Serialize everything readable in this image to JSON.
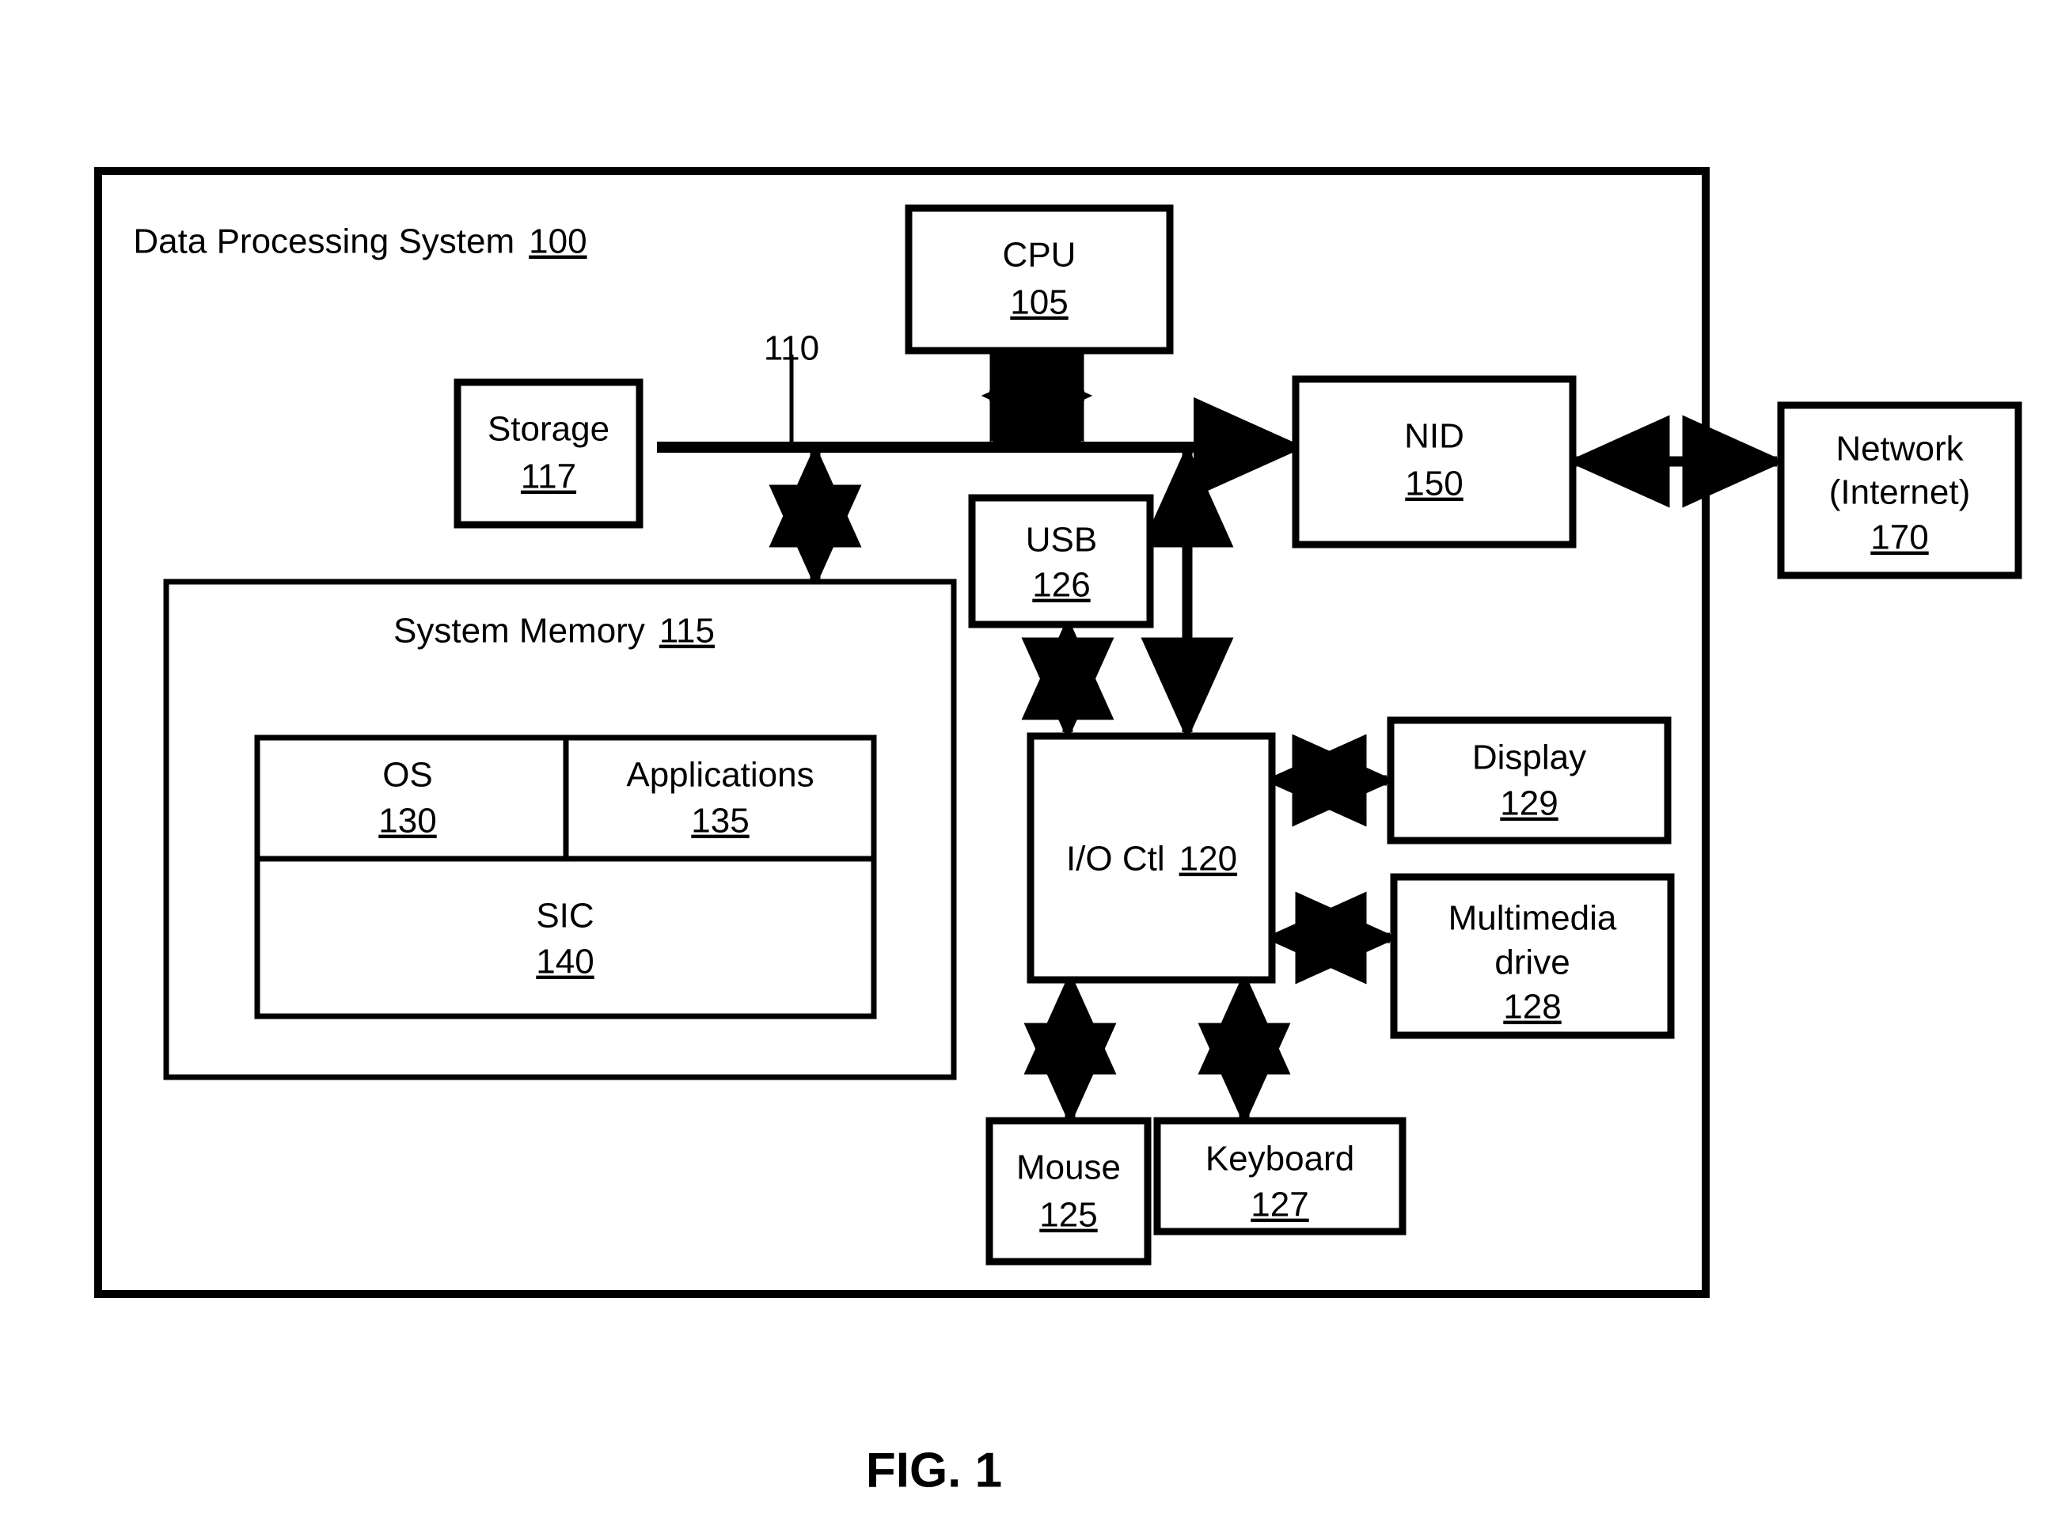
{
  "figure": {
    "caption": "FIG. 1"
  },
  "system": {
    "title_text": "Data Processing System",
    "title_ref": "100"
  },
  "bus": {
    "ref": "110"
  },
  "blocks": {
    "cpu": {
      "label": "CPU",
      "ref": "105"
    },
    "storage": {
      "label": "Storage",
      "ref": "117"
    },
    "nid": {
      "label": "NID",
      "ref": "150"
    },
    "network": {
      "label_line1": "Network",
      "label_line2": "(Internet)",
      "ref": "170"
    },
    "usb": {
      "label": "USB",
      "ref": "126"
    },
    "io_ctl": {
      "label": "I/O Ctl",
      "ref": "120"
    },
    "display": {
      "label": "Display",
      "ref": "129"
    },
    "multimedia": {
      "label_line1": "Multimedia",
      "label_line2": "drive",
      "ref": "128"
    },
    "mouse": {
      "label": "Mouse",
      "ref": "125"
    },
    "keyboard": {
      "label": "Keyboard",
      "ref": "127"
    },
    "system_memory": {
      "label": "System Memory",
      "ref": "115"
    },
    "os": {
      "label": "OS",
      "ref": "130"
    },
    "applications": {
      "label": "Applications",
      "ref": "135"
    },
    "sic": {
      "label": "SIC",
      "ref": "140"
    }
  },
  "colors": {
    "line": "#000000",
    "fill": "#ffffff"
  }
}
